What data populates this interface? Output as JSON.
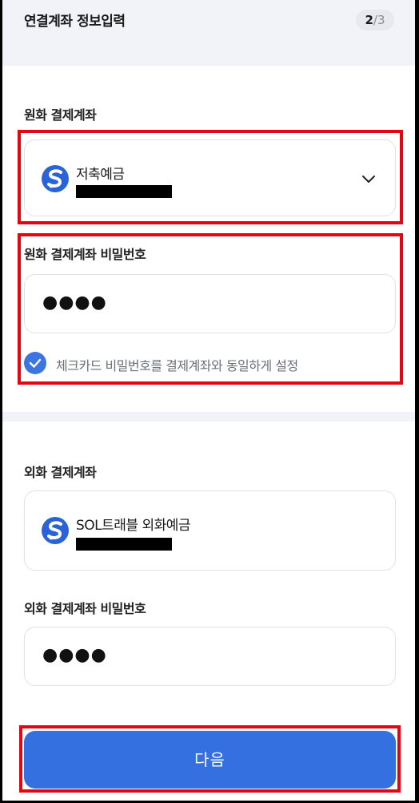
{
  "header": {
    "title": "연결계좌 정보입력",
    "step_current": "2",
    "step_separator": "/",
    "step_total": "3"
  },
  "krw_account": {
    "label": "원화 결제계좌",
    "bank_icon": "shinhan-bank-logo",
    "account_name": "저축예금",
    "account_number_masked": true,
    "dropdown_icon": "chevron-down-icon"
  },
  "krw_password": {
    "label": "원화 결제계좌 비밀번호",
    "value": "●●●●",
    "same_as_account_checkbox": {
      "checked": true,
      "label": "체크카드 비밀번호를 결제계좌와 동일하게 설정"
    }
  },
  "foreign_account": {
    "label": "외화 결제계좌",
    "bank_icon": "shinhan-bank-logo",
    "account_name": "SOL트래블 외화예금",
    "account_number_masked": true
  },
  "foreign_password": {
    "label": "외화 결제계좌 비밀번호",
    "value": "●●●●"
  },
  "next_button": {
    "label": "다음"
  },
  "colors": {
    "accent": "#3470e0",
    "highlight": "#e30613",
    "background": "#f1f3f8"
  }
}
